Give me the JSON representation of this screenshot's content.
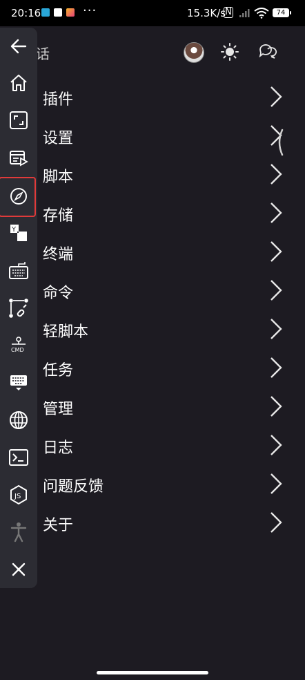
{
  "status_bar": {
    "time": "20:16",
    "network_speed": "15.3K/s",
    "nfc_label": "N",
    "battery": "74",
    "more_indicator": "···"
  },
  "header": {
    "partial_title": "话",
    "avatar": "avatar",
    "theme_icon": "sun-icon",
    "chat_icon": "chat-icon"
  },
  "menu": {
    "items": [
      {
        "label": "插件"
      },
      {
        "label": "设置"
      },
      {
        "label": "脚本"
      },
      {
        "label": "存储"
      },
      {
        "label": "终端"
      },
      {
        "label": "命令"
      },
      {
        "label": "轻脚本"
      },
      {
        "label": "任务"
      },
      {
        "label": "管理"
      },
      {
        "label": "日志"
      },
      {
        "label": "问题反馈"
      },
      {
        "label": "关于"
      }
    ]
  },
  "rail": {
    "items": [
      {
        "icon": "back-arrow-icon"
      },
      {
        "icon": "home-icon"
      },
      {
        "icon": "fullscreen-icon"
      },
      {
        "icon": "media-list-icon"
      },
      {
        "icon": "compass-icon",
        "selected": true
      },
      {
        "icon": "translate-icon"
      },
      {
        "icon": "keyboard-icon"
      },
      {
        "icon": "link-nodes-icon"
      },
      {
        "icon": "cmd-icon"
      },
      {
        "icon": "keyboard-hide-icon"
      },
      {
        "icon": "globe-icon"
      },
      {
        "icon": "terminal-icon"
      },
      {
        "icon": "nodejs-icon"
      },
      {
        "icon": "accessibility-icon"
      },
      {
        "icon": "close-icon"
      }
    ],
    "cmd_label": "CMD",
    "js_label": "JS",
    "translate_label": "Y"
  },
  "colors": {
    "background": "#1d1b22",
    "rail": "#2c2c33",
    "selected_outline": "#e03a3a"
  }
}
